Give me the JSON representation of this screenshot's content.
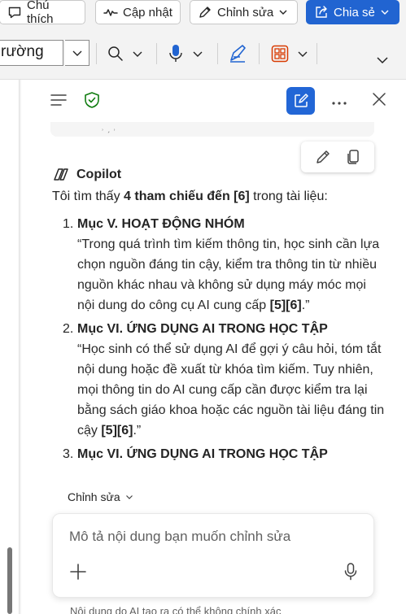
{
  "toolbar": {
    "comment_label": "Chú thích",
    "catchup_label": "Cập nhật",
    "edit_label": "Chỉnh sửa",
    "share_label": "Chia sẻ"
  },
  "ribbon": {
    "style_value": "rường"
  },
  "copilot": {
    "author": "Copilot",
    "intro_prefix": "Tôi tìm thấy ",
    "intro_bold": "4 tham chiếu đến [6]",
    "intro_suffix": " trong tài liệu:",
    "items": [
      {
        "num": "1.",
        "section": "Mục V. HOẠT ĐỘNG NHÓM",
        "quote": "“Trong quá trình tìm kiếm thông tin, học sinh cần lựa chọn nguồn đáng tin cậy, kiểm tra thông tin từ nhiều nguồn khác nhau và không sử dụng máy móc mọi nội dung do công cụ AI cung cấp ",
        "cite": "[5][6]",
        "end": ".”"
      },
      {
        "num": "2.",
        "section": "Mục VI. ỨNG DỤNG AI TRONG HỌC TẬP",
        "quote": "“Học sinh có thể sử dụng AI để gợi ý câu hỏi, tóm tắt nội dung hoặc đề xuất từ khóa tìm kiếm. Tuy nhiên, mọi thông tin do AI cung cấp cần được kiểm tra lại bằng sách giáo khoa hoặc các nguồn tài liệu đáng tin cậy ",
        "cite": "[5][6]",
        "end": ".”"
      },
      {
        "num": "3.",
        "section": "Mục VI. ỨNG DỤNG AI TRONG HỌC TẬP",
        "quote": "",
        "cite": "",
        "end": ""
      }
    ],
    "edit_mode_label": "Chỉnh sửa",
    "composer_placeholder": "Mô tả nội dung bạn muốn chỉnh sửa",
    "disclaimer": "Nội dung do AI tạo ra có thể không chính xác"
  },
  "colors": {
    "accent": "#2164d1",
    "shield": "#107c10",
    "design_icon": "#d83b01"
  }
}
